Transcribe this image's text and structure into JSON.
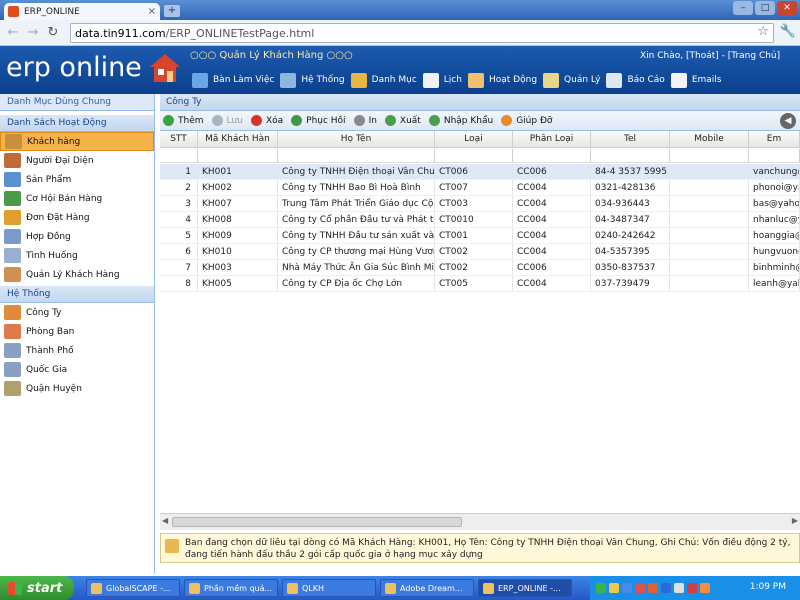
{
  "browser": {
    "tab_title": "ERP_ONLINE",
    "url_host": "data.tin911.com",
    "url_path": "/ERP_ONLINETestPage.html"
  },
  "app": {
    "logo": "erp online",
    "title": "○○○ Quản Lý Khách Hàng ○○○",
    "greeting": "Xin Chào,",
    "logout": "[Thoát]",
    "home": "[Trang Chủ]",
    "separator": "-",
    "menu": [
      {
        "label": "Bàn Làm Việc",
        "icon": "desktop-icon",
        "color": "#6aa6e8"
      },
      {
        "label": "Hệ Thống",
        "icon": "monitor-icon",
        "color": "#8fb6dd"
      },
      {
        "label": "Danh Mục",
        "icon": "folder-icon",
        "color": "#e9b545"
      },
      {
        "label": "Lịch",
        "icon": "calendar-icon",
        "color": "#f2f2f2"
      },
      {
        "label": "Hoạt Động",
        "icon": "people-icon",
        "color": "#f0c070"
      },
      {
        "label": "Quản Lý",
        "icon": "edit-icon",
        "color": "#e6d58a"
      },
      {
        "label": "Báo Cáo",
        "icon": "report-icon",
        "color": "#dfe6ee"
      },
      {
        "label": "Emails",
        "icon": "mail-icon",
        "color": "#f4f4f4"
      }
    ]
  },
  "sidebar": {
    "section_title": "Danh Mục Dùng Chung",
    "group1_title": "Danh Sách Hoạt Động",
    "group1": [
      {
        "label": "Khách hàng",
        "icon": "customer-book-icon",
        "color": "#c8903a"
      },
      {
        "label": "Người Đại Diện",
        "icon": "person-icon",
        "color": "#c06a3a"
      },
      {
        "label": "Sản Phẩm",
        "icon": "product-icon",
        "color": "#5a8fd0"
      },
      {
        "label": "Cơ Hội Bán Hàng",
        "icon": "money-icon",
        "color": "#4a9a4a"
      },
      {
        "label": "Đơn Đặt Hàng",
        "icon": "order-icon",
        "color": "#e0a030"
      },
      {
        "label": "Hợp Đồng",
        "icon": "contract-icon",
        "color": "#7a9ac8"
      },
      {
        "label": "Tình Huống",
        "icon": "case-icon",
        "color": "#9ab0d0"
      },
      {
        "label": "Quản Lý Khách Hàng",
        "icon": "customers-icon",
        "color": "#d09050"
      }
    ],
    "group2_title": "Hệ Thống",
    "group2": [
      {
        "label": "Công Ty",
        "icon": "company-icon",
        "color": "#e08a3a"
      },
      {
        "label": "Phòng Ban",
        "icon": "department-icon",
        "color": "#e07a4a"
      },
      {
        "label": "Thành Phố",
        "icon": "city-icon",
        "color": "#8aa0c0"
      },
      {
        "label": "Quốc Gia",
        "icon": "country-icon",
        "color": "#8aa0c0"
      },
      {
        "label": "Quận Huyện",
        "icon": "district-icon",
        "color": "#b0a070"
      }
    ]
  },
  "main": {
    "breadcrumb": "Công Ty",
    "toolbar": [
      {
        "label": "Thêm",
        "icon": "add-icon",
        "color": "#3aa53a",
        "enabled": true
      },
      {
        "label": "Lưu",
        "icon": "save-icon",
        "color": "#a8b4c4",
        "enabled": false
      },
      {
        "label": "Xóa",
        "icon": "delete-icon",
        "color": "#d8352a",
        "enabled": true
      },
      {
        "label": "Phục Hồi",
        "icon": "restore-icon",
        "color": "#3a9a4a",
        "enabled": true
      },
      {
        "label": "In",
        "icon": "print-icon",
        "color": "#8a8a8a",
        "enabled": true
      },
      {
        "label": "Xuất",
        "icon": "export-icon",
        "color": "#4aa04a",
        "enabled": true
      },
      {
        "label": "Nhập Khẩu",
        "icon": "import-icon",
        "color": "#4aa04a",
        "enabled": true
      },
      {
        "label": "Giúp Đỡ",
        "icon": "help-icon",
        "color": "#e88a2a",
        "enabled": true
      }
    ],
    "columns": [
      "STT",
      "Mã Khách Hàn",
      "Họ Tên",
      "Loại",
      "Phân Loại",
      "Tel",
      "Mobile",
      "Em"
    ],
    "rows": [
      [
        "1",
        "KH001",
        "Công ty TNHH Điện thoại Vân Chun",
        "CT006",
        "CC006",
        "84-4 3537 5995",
        "",
        "vanchung@"
      ],
      [
        "2",
        "KH002",
        "Công ty TNHH  Bao Bì Hoà  Bình",
        "CT007",
        "CC004",
        "0321-428136",
        "",
        "phonoi@ya"
      ],
      [
        "3",
        "KH007",
        "Trung Tâm Phát Triển Giáo dục Cộ",
        "CT003",
        "CC004",
        "034-936443",
        "",
        "bas@yahoo"
      ],
      [
        "4",
        "KH008",
        "Công ty Cổ phần Đầu tư và Phát tr",
        "CT0010",
        "CC004",
        "04-3487347",
        "",
        "nhanluc@y"
      ],
      [
        "5",
        "KH009",
        "Công ty TNHH Đầu tư sản xuất và",
        "CT001",
        "CC004",
        "0240-242642",
        "",
        "hoanggia@"
      ],
      [
        "6",
        "KH010",
        "Công ty CP thương mại Hùng Vươn",
        "CT002",
        "CC004",
        "04-5357395",
        "",
        "hungvuong"
      ],
      [
        "7",
        "KH003",
        "Nhà Máy Thức Ăn Gia Súc Bình Mir",
        "CT002",
        "CC006",
        "0350-837537",
        "",
        "binhminh@"
      ],
      [
        "8",
        "KH005",
        "Công ty CP Địa ốc Chợ Lớn",
        "CT005",
        "CC004",
        "037-739479",
        "",
        "leanh@yah"
      ]
    ],
    "selected_row": 0,
    "status": "Ban đang chọn dữ liêu tại dòng có Mã Khách Hàng: KH001, Họ Tên: Công ty TNHH Điện thoại Vân Chung, Ghi Chú: Vốn điều động 2 tỷ, đang tiến hành đấu thầu 2 gói cấp quốc gia ở hạng mục xây dựng"
  },
  "taskbar": {
    "start": "start",
    "tasks": [
      "GlobalSCAPE -...",
      "Phần mềm quả...",
      "QLKH",
      "Adobe Dream...",
      "ERP_ONLINE -..."
    ],
    "active_task": 4,
    "clock": "1:09 PM"
  }
}
